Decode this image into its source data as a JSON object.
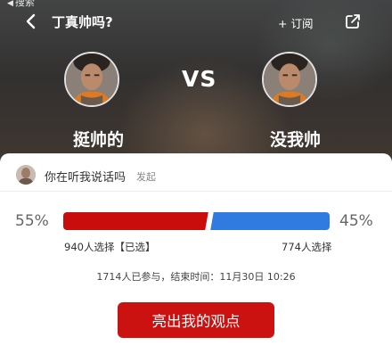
{
  "status_bar": {
    "back_label": "搜索"
  },
  "header": {
    "title": "丁真帅吗?",
    "follow_label": "+ 订阅"
  },
  "versus": {
    "vs_label": "VS",
    "left_label": "挺帅的",
    "right_label": "没我帅"
  },
  "poll": {
    "question": "你在听我说话吗",
    "role": "发起",
    "left_percent": "55%",
    "right_percent": "45%",
    "left_fraction": 0.55,
    "right_fraction": 0.45,
    "left_count": "940人选择【已选】",
    "right_count": "774人选择",
    "meta": "1714人已参与，结束时间：11月30日 10:26",
    "cta_label": "亮出我的观点"
  },
  "colors": {
    "left_bar": "#c90d0d",
    "right_bar": "#2f7bdf",
    "cta": "#cc1111"
  },
  "icons": {
    "back": "chevron-left-icon",
    "share": "share-icon"
  }
}
